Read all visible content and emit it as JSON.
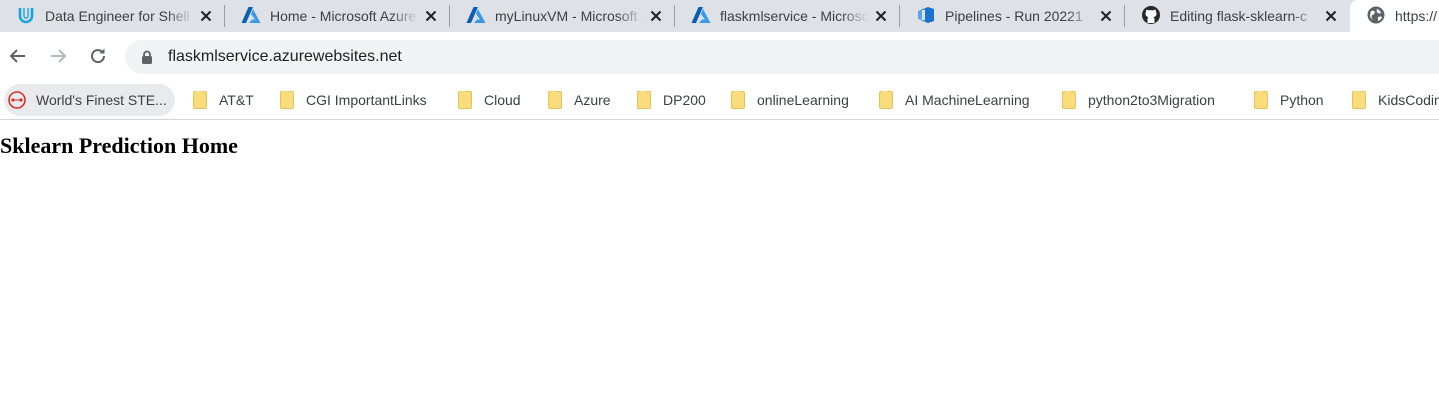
{
  "browser": {
    "tabs": [
      {
        "title": "Data Engineer for Shell",
        "icon": "udemy-icon",
        "active": false
      },
      {
        "title": "Home - Microsoft Azure",
        "icon": "azure-icon",
        "active": false
      },
      {
        "title": "myLinuxVM - Microsoft Azure",
        "icon": "azure-icon",
        "active": false
      },
      {
        "title": "flaskmlservice - Microsoft Azure",
        "icon": "azure-icon",
        "active": false
      },
      {
        "title": "Pipelines - Run 20221",
        "icon": "azure-devops-icon",
        "active": false
      },
      {
        "title": "Editing flask-sklearn-c",
        "icon": "github-icon",
        "active": false
      },
      {
        "title": "https://",
        "icon": "globe-icon",
        "active": true
      }
    ],
    "address_bar": {
      "url": "flaskmlservice.azurewebsites.net"
    },
    "bookmarks": [
      {
        "label": "World's Finest STE...",
        "icon": "site-icon"
      },
      {
        "label": "AT&T",
        "icon": "folder-icon"
      },
      {
        "label": "CGI ImportantLinks",
        "icon": "folder-icon"
      },
      {
        "label": "Cloud",
        "icon": "folder-icon"
      },
      {
        "label": "Azure",
        "icon": "folder-icon"
      },
      {
        "label": "DP200",
        "icon": "folder-icon"
      },
      {
        "label": "onlineLearning",
        "icon": "folder-icon"
      },
      {
        "label": "AI MachineLearning",
        "icon": "folder-icon"
      },
      {
        "label": "python2to3Migration",
        "icon": "folder-icon"
      },
      {
        "label": "Python",
        "icon": "folder-icon"
      },
      {
        "label": "KidsCoding",
        "icon": "folder-icon"
      }
    ]
  },
  "page": {
    "heading": "Sklearn Prediction Home"
  },
  "colors": {
    "tabstrip_bg": "#dee1e6",
    "omnibox_bg": "#f1f3f4",
    "azure_blue": "#0078d4",
    "udemy_blue": "#1aa4e0",
    "folder_yellow": "#f9dd7c"
  }
}
